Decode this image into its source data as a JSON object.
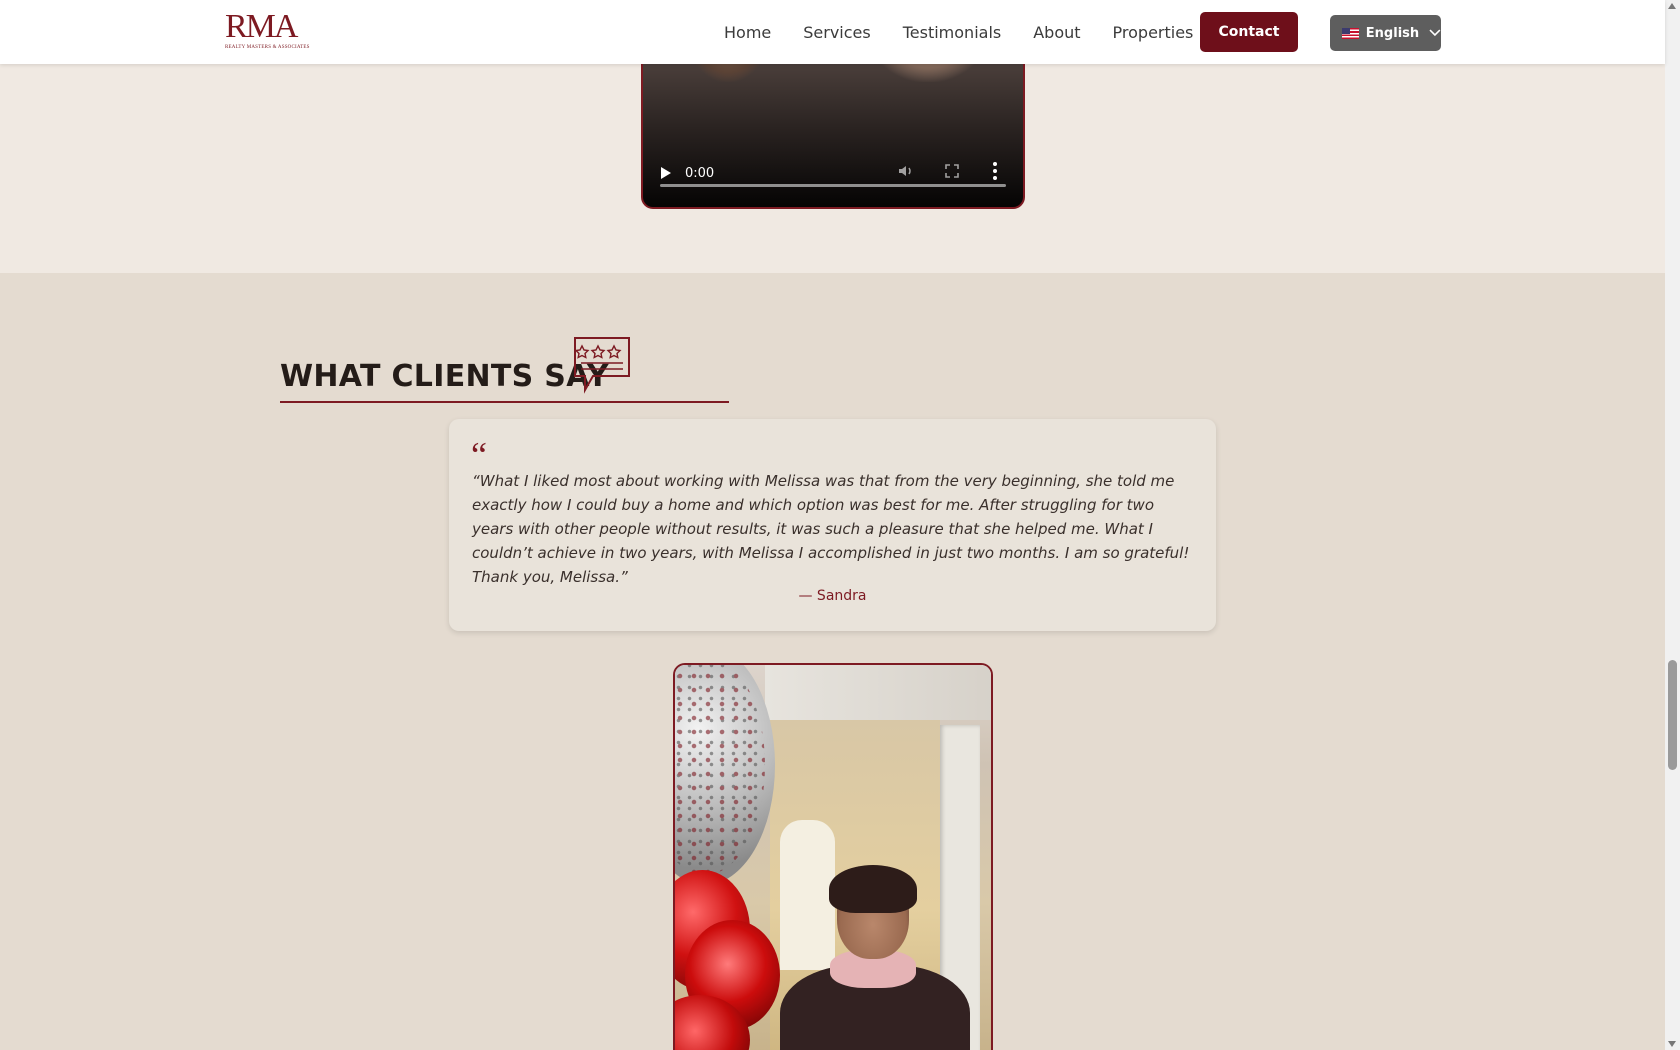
{
  "header": {
    "logo_text": "RMA",
    "logo_subtext": "REALTY MASTERS & ASSOCIATES",
    "nav": [
      "Home",
      "Services",
      "Testimonials",
      "About",
      "Properties"
    ],
    "contact_label": "Contact",
    "language": "English"
  },
  "video": {
    "time": "0:00",
    "progress": 0
  },
  "clients": {
    "heading": "WHAT CLIENTS SAY",
    "quote_mark": "“",
    "quote": "“What I liked most about working with Melissa was that from the very beginning, she told me exactly how I could buy a home and which option was best for me. After struggling for two years with other people without results, it was such a pleasure that she helped me. What I couldn’t achieve in two years, with Melissa I accomplished in just two months. I am so grateful! Thank you, Melissa.”",
    "author": "— Sandra"
  },
  "colors": {
    "brand": "#7d1a22",
    "contact_bg": "#6e0f1a",
    "section_bg": "#e4dbd0",
    "video_section_bg": "#f0e9e2"
  }
}
